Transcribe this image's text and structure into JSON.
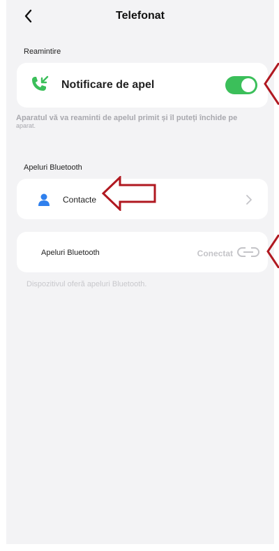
{
  "header": {
    "title": "Telefonat",
    "back_icon": "chevron-left-icon"
  },
  "reminder": {
    "section_label": "Reamintire",
    "call_notification_label": "Notificare de apel",
    "call_notification_icon": "incoming-call-icon",
    "toggle_on": true,
    "description_line1": "Aparatul vă va reaminti de apelul primit și îl puteți închide pe",
    "description_line2": "aparat."
  },
  "bluetooth_calls": {
    "section_label": "Apeluri Bluetooth",
    "contacts_label": "Contacte",
    "contacts_icon": "person-icon",
    "row_label": "Apeluri Bluetooth",
    "status": "Conectat",
    "status_icon": "link-icon",
    "description": "Dispozitivul oferă apeluri Bluetooth."
  },
  "colors": {
    "accent_green": "#3bbf5a",
    "icon_blue": "#2f80ed",
    "annotation_arrow": "#b01820",
    "background": "#f3f3f5",
    "card": "#ffffff"
  }
}
